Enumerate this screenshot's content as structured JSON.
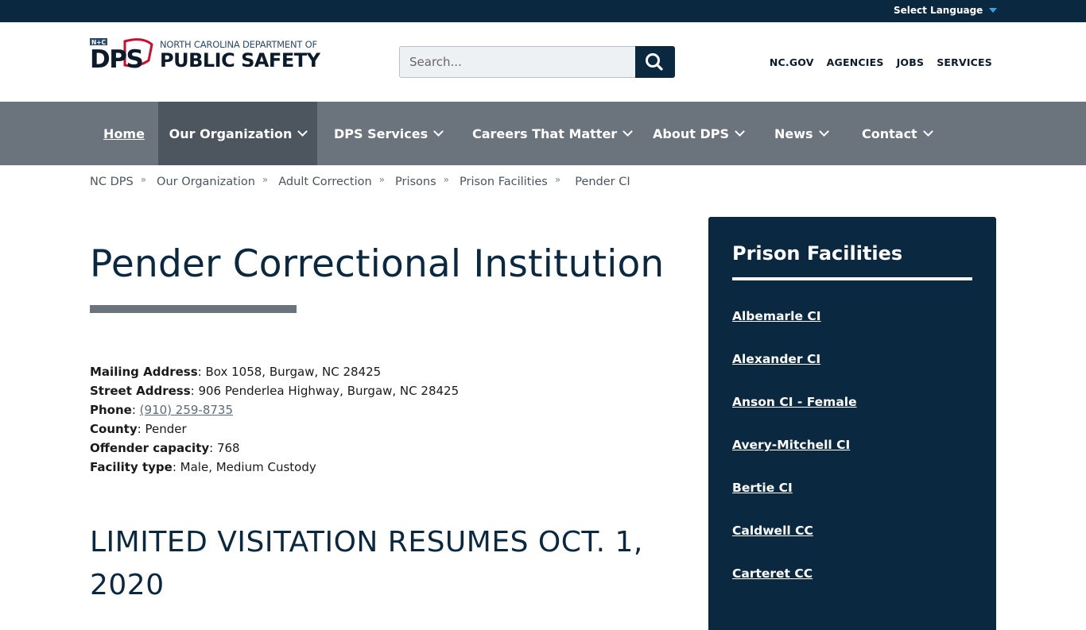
{
  "utility": {
    "language_label": "Select Language"
  },
  "header": {
    "logo_badge": "N+C",
    "logo_letters": "DPS",
    "logo_top": "NORTH CAROLINA DEPARTMENT OF",
    "logo_main": "PUBLIC SAFETY",
    "search_placeholder": "Search...",
    "links": [
      "NC.GOV",
      "AGENCIES",
      "JOBS",
      "SERVICES"
    ]
  },
  "nav": {
    "items": [
      {
        "label": "Home"
      },
      {
        "label": "Our Organization"
      },
      {
        "label": "DPS Services"
      },
      {
        "label": "Careers That Matter"
      },
      {
        "label": "About DPS"
      },
      {
        "label": "News"
      },
      {
        "label": "Contact"
      }
    ]
  },
  "breadcrumb": {
    "items": [
      "NC DPS",
      "Our Organization",
      "Adult Correction",
      "Prisons",
      "Prison Facilities",
      "Pender CI"
    ],
    "separator": "»"
  },
  "main": {
    "title": "Pender Correctional Institution",
    "facts": [
      {
        "label": "Mailing Address",
        "value": "Box 1058, Burgaw, NC 28425"
      },
      {
        "label": "Street Address",
        "value": "906 Penderlea Highway, Burgaw, NC 28425"
      },
      {
        "label": "Phone",
        "value": "(910) 259-8735"
      },
      {
        "label": "County",
        "value": "Pender"
      },
      {
        "label": "Offender capacity",
        "value": "768"
      },
      {
        "label": "Facility type",
        "value": "Male, Medium Custody"
      }
    ],
    "section_title": "LIMITED VISITATION RESUMES OCT. 1, 2020"
  },
  "sidebar": {
    "title": "Prison Facilities",
    "items": [
      "Albemarle CI",
      "Alexander CI",
      "Anson CI - Female",
      "Avery-Mitchell CI",
      "Bertie CI",
      "Caldwell CC",
      "Carteret CC"
    ]
  },
  "colors": {
    "navy": "#0b2841",
    "nav_gray": "#6b737d",
    "nav_active": "#4d555e",
    "logo_red": "#c8102e"
  }
}
